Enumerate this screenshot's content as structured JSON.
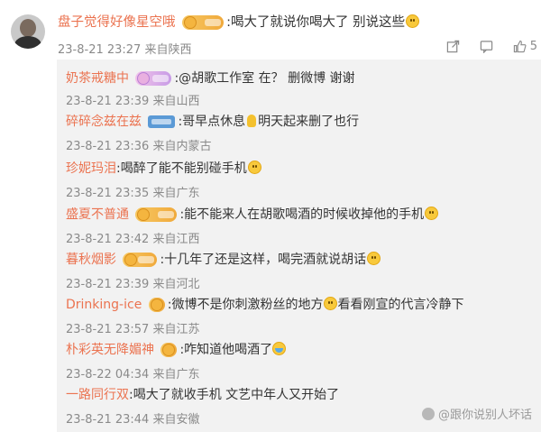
{
  "comment": {
    "username": "盘子觉得好像星空哦",
    "text": ":喝大了就说你喝大了 别说这些",
    "time": "23-8-21 23:27",
    "location": "来自陕西",
    "like_count": "5"
  },
  "replies": [
    {
      "username": "奶茶戒糖中",
      "text": ":@胡歌工作室 在？ 删微博 谢谢",
      "time": "23-8-21 23:39",
      "location": "来自山西"
    },
    {
      "username": "碎碎念兹在兹",
      "text_a": ":哥早点休息",
      "text_b": "明天起来删了也行",
      "time": "23-8-21 23:36",
      "location": "来自内蒙古"
    },
    {
      "username": "珍妮玛泪",
      "text": ":喝醉了能不能别碰手机",
      "time": "23-8-21 23:35",
      "location": "来自广东"
    },
    {
      "username": "盛夏不普通",
      "text": ":能不能来人在胡歌喝酒的时候收掉他的手机",
      "time": "23-8-21 23:42",
      "location": "来自江西"
    },
    {
      "username": "暮秋烟影",
      "text": ":十几年了还是这样，喝完酒就说胡话",
      "time": "23-8-21 23:39",
      "location": "来自河北"
    },
    {
      "username": "Drinking-ice",
      "text_a": ":微博不是你刺激粉丝的地方",
      "text_b": "看看刚宣的代言冷静下",
      "time": "23-8-21 23:57",
      "location": "来自江苏"
    },
    {
      "username": "朴彩英无降媚神",
      "text": ":咋知道他喝酒了",
      "time": "23-8-22 04:34",
      "location": "来自广东"
    },
    {
      "username": "一路同行双",
      "text": ":喝大了就收手机 文艺中年人又开始了",
      "time": "23-8-21 23:44",
      "location": "来自安徽"
    }
  ],
  "watermark": "@跟你说别人坏话",
  "colors": {
    "username": "#eb7350",
    "meta": "#8a8a8a",
    "reply_bg": "#f2f2f2"
  }
}
